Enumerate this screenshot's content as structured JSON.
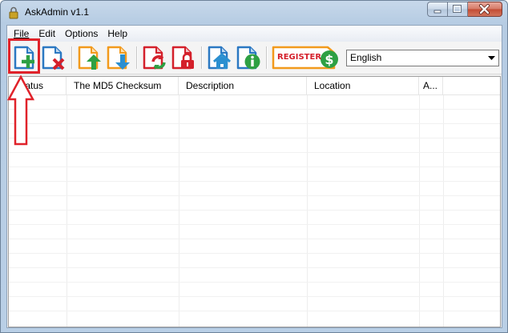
{
  "window": {
    "title": "AskAdmin v1.1"
  },
  "menu": {
    "file": "File",
    "edit": "Edit",
    "options": "Options",
    "help": "Help"
  },
  "toolbar": {
    "buttons": [
      {
        "name": "add",
        "icon": "add-file-icon"
      },
      {
        "name": "remove",
        "icon": "remove-file-icon"
      },
      {
        "name": "import",
        "icon": "import-icon"
      },
      {
        "name": "export",
        "icon": "export-icon"
      },
      {
        "name": "restart-explorer",
        "icon": "refresh-icon"
      },
      {
        "name": "unblock",
        "icon": "lock-icon"
      },
      {
        "name": "home",
        "icon": "home-icon"
      },
      {
        "name": "about",
        "icon": "info-icon"
      }
    ],
    "register_label": "REGISTER",
    "language": "English"
  },
  "list": {
    "columns": [
      "Status",
      "The MD5 Checksum",
      "Description",
      "Location",
      "A..."
    ],
    "rows": []
  },
  "colors": {
    "accent_blue": "#2b78c2",
    "accent_green": "#2ea043",
    "accent_red": "#d4202b",
    "accent_orange": "#f29a1c",
    "annotation_red": "#e0222a"
  }
}
